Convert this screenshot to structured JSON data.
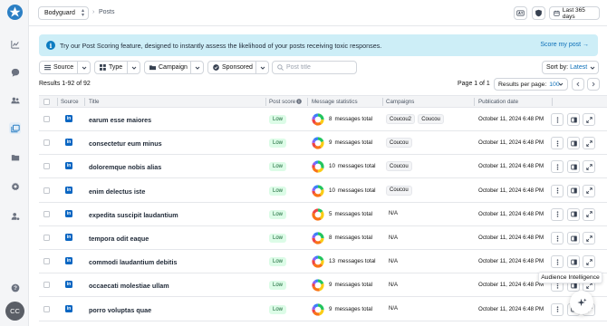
{
  "app": {
    "workspace": "Bodyguard",
    "breadcrumb": "Posts",
    "avatar_initials": "CC",
    "date_range": "Last 365 days"
  },
  "banner": {
    "text": "Try our Post Scoring feature, designed to instantly assess the likelihood of your posts receiving toxic responses.",
    "link": "Score my post →"
  },
  "filters": {
    "source": "Source",
    "type": "Type",
    "campaign": "Campaign",
    "sponsored": "Sponsored",
    "search_placeholder": "Post title",
    "sort_label": "Sort by:",
    "sort_value": "Latest"
  },
  "results": {
    "summary": "Results 1-92 of 92",
    "page_of": "Page 1 of 1",
    "per_page_label": "Results per page:",
    "per_page_value": "100"
  },
  "columns": {
    "source": "Source",
    "title": "Title",
    "post_score": "Post score",
    "message_statistics": "Message statistics",
    "campaigns": "Campaigns",
    "publication_date": "Publication date"
  },
  "rows": [
    {
      "title": "earum esse maiores",
      "score": "Low",
      "messages": "8",
      "messages_suffix": "messages total",
      "campaigns": [
        "Coucou2",
        "Coucou"
      ],
      "date": "October 11, 2024 6:48 PM"
    },
    {
      "title": "consectetur eum minus",
      "score": "Low",
      "messages": "9",
      "messages_suffix": "messages total",
      "campaigns": [
        "Coucou"
      ],
      "date": "October 11, 2024 6:48 PM"
    },
    {
      "title": "doloremque nobis alias",
      "score": "Low",
      "messages": "10",
      "messages_suffix": "messages total",
      "campaigns": [
        "Coucou"
      ],
      "date": "October 11, 2024 6:48 PM"
    },
    {
      "title": "enim delectus iste",
      "score": "Low",
      "messages": "10",
      "messages_suffix": "messages total",
      "campaigns": [
        "Coucou"
      ],
      "date": "October 11, 2024 6:48 PM"
    },
    {
      "title": "expedita suscipit laudantium",
      "score": "Low",
      "messages": "5",
      "messages_suffix": "messages total",
      "campaigns": [
        "N/A"
      ],
      "date": "October 11, 2024 6:48 PM"
    },
    {
      "title": "tempora odit eaque",
      "score": "Low",
      "messages": "8",
      "messages_suffix": "messages total",
      "campaigns": [
        "N/A"
      ],
      "date": "October 11, 2024 6:48 PM"
    },
    {
      "title": "commodi laudantium debitis",
      "score": "Low",
      "messages": "13",
      "messages_suffix": "messages total",
      "campaigns": [
        "N/A"
      ],
      "date": "October 11, 2024 6:48 PM"
    },
    {
      "title": "occaecati molestiae ullam",
      "score": "Low",
      "messages": "9",
      "messages_suffix": "messages total",
      "campaigns": [
        "N/A"
      ],
      "date": "October 11, 2024 6:48 PM"
    },
    {
      "title": "porro voluptas quae",
      "score": "Low",
      "messages": "9",
      "messages_suffix": "messages total",
      "campaigns": [
        "N/A"
      ],
      "date": "October 11, 2024 6:48 PM"
    }
  ],
  "tooltip": "Audience Intelligence",
  "source_badge": "in",
  "icons": {
    "nav": [
      "chart-icon",
      "chat-icon",
      "users-icon",
      "posts-icon",
      "folder-icon",
      "gear-icon",
      "user-settings-icon"
    ],
    "help": "help-icon"
  },
  "colors": {
    "accent": "#0c6fb8",
    "banner_bg": "#cdeef7",
    "badge_low_bg": "#dcfce7",
    "badge_low_text": "#166534",
    "linkedin": "#0a66c2"
  }
}
